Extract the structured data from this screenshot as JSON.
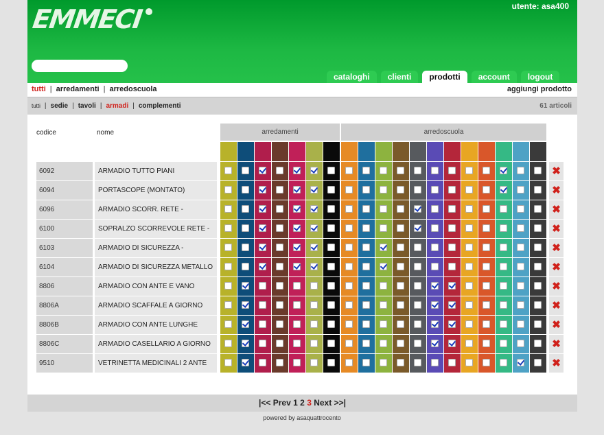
{
  "header": {
    "logo": "EMMECI",
    "user": "utente: asa400",
    "search": {
      "placeholder": "",
      "value": ""
    },
    "tabs": [
      {
        "label": "cataloghi",
        "active": false
      },
      {
        "label": "clienti",
        "active": false
      },
      {
        "label": "prodotti",
        "active": true
      },
      {
        "label": "account",
        "active": false
      },
      {
        "label": "logout",
        "active": false
      }
    ]
  },
  "nav1": {
    "items": [
      "tutti",
      "arredamenti",
      "arredoscuola"
    ],
    "active": "tutti",
    "add_product": "aggiungi prodotto"
  },
  "nav2": {
    "items": [
      "tutti",
      "sedie",
      "tavoli",
      "armadi",
      "complementi"
    ],
    "active": "armadi",
    "count": "61 articoli"
  },
  "table": {
    "col_codice": "codice",
    "col_nome": "nome",
    "groups": [
      "arredamenti",
      "arredoscuola"
    ],
    "colors": [
      "#b8b22a",
      "#0e4d79",
      "#b01e4c",
      "#6a3a2b",
      "#c02058",
      "#a9b14a",
      "#0a0a0a",
      "#e68a25",
      "#1f6f9e",
      "#8db33f",
      "#7a5a2a",
      "#575a5e",
      "#5a4bb5",
      "#b4263a",
      "#e8a623",
      "#d9572a",
      "#35b985",
      "#4ea2c5",
      "#3a3a3a"
    ],
    "rows": [
      {
        "code": "6092",
        "name": "ARMADIO TUTTO PIANI",
        "checks": [
          0,
          0,
          1,
          0,
          1,
          1,
          0,
          0,
          0,
          0,
          0,
          0,
          0,
          0,
          0,
          0,
          1,
          0,
          0
        ]
      },
      {
        "code": "6094",
        "name": "PORTASCOPE (MONTATO)",
        "checks": [
          0,
          0,
          1,
          0,
          1,
          1,
          0,
          0,
          0,
          0,
          0,
          0,
          0,
          0,
          0,
          0,
          1,
          0,
          0
        ]
      },
      {
        "code": "6096",
        "name": "ARMADIO SCORR. RETE -",
        "checks": [
          0,
          0,
          1,
          0,
          1,
          1,
          0,
          0,
          0,
          0,
          0,
          1,
          0,
          0,
          0,
          0,
          0,
          0,
          0
        ]
      },
      {
        "code": "6100",
        "name": "SOPRALZO SCORREVOLE RETE -",
        "checks": [
          0,
          0,
          1,
          0,
          1,
          1,
          0,
          0,
          0,
          0,
          0,
          1,
          0,
          0,
          0,
          0,
          0,
          0,
          0
        ]
      },
      {
        "code": "6103",
        "name": "ARMADIO DI SICUREZZA -",
        "checks": [
          0,
          0,
          1,
          0,
          1,
          1,
          0,
          0,
          0,
          1,
          0,
          0,
          0,
          0,
          0,
          0,
          0,
          0,
          0
        ]
      },
      {
        "code": "6104",
        "name": "ARMADIO DI SICUREZZA METALLO",
        "checks": [
          0,
          0,
          1,
          0,
          1,
          1,
          0,
          0,
          0,
          1,
          0,
          0,
          0,
          0,
          0,
          0,
          0,
          0,
          0
        ]
      },
      {
        "code": "8806",
        "name": "ARMADIO CON ANTE E VANO",
        "checks": [
          0,
          1,
          0,
          0,
          0,
          0,
          0,
          0,
          0,
          0,
          0,
          0,
          1,
          1,
          0,
          0,
          0,
          0,
          0
        ]
      },
      {
        "code": "8806A",
        "name": "ARMADIO SCAFFALE A GIORNO",
        "checks": [
          0,
          1,
          0,
          0,
          0,
          0,
          0,
          0,
          0,
          0,
          0,
          0,
          1,
          1,
          0,
          0,
          0,
          0,
          0
        ]
      },
      {
        "code": "8806B",
        "name": "ARMADIO CON ANTE LUNGHE",
        "checks": [
          0,
          1,
          0,
          0,
          0,
          0,
          0,
          0,
          0,
          0,
          0,
          0,
          1,
          1,
          0,
          0,
          0,
          0,
          0
        ]
      },
      {
        "code": "8806C",
        "name": "ARMADIO CASELLARIO A GIORNO",
        "checks": [
          0,
          1,
          0,
          0,
          0,
          0,
          0,
          0,
          0,
          0,
          0,
          0,
          1,
          1,
          0,
          0,
          0,
          0,
          0
        ]
      },
      {
        "code": "9510",
        "name": "VETRINETTA MEDICINALI 2 ANTE",
        "checks": [
          0,
          1,
          0,
          0,
          0,
          0,
          0,
          0,
          0,
          0,
          0,
          0,
          0,
          0,
          0,
          0,
          0,
          1,
          0
        ]
      }
    ],
    "delete_glyph": "✖"
  },
  "pager": {
    "first": "|<<",
    "prev": "Prev",
    "pages": [
      "1",
      "2",
      "3"
    ],
    "current": "3",
    "next": "Next",
    "last": ">>|"
  },
  "footer": {
    "powered": "powered by asaquattrocento"
  }
}
